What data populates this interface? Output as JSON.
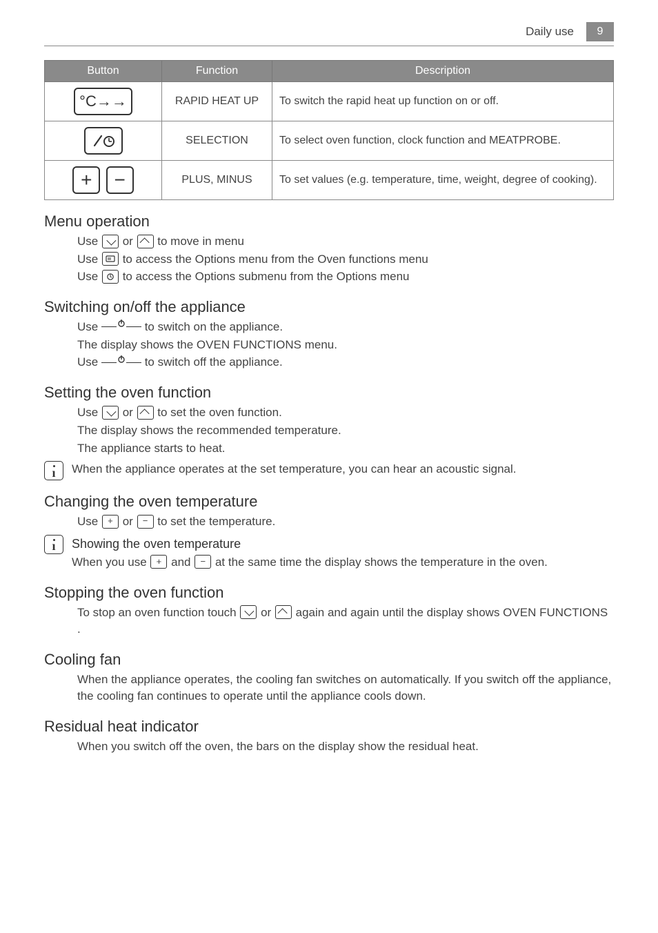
{
  "header": {
    "section": "Daily use",
    "page": "9"
  },
  "table": {
    "headers": {
      "button": "Button",
      "function": "Function",
      "description": "Description"
    },
    "rows": [
      {
        "function": "RAPID HEAT UP",
        "description": "To switch the rapid heat up function on or off."
      },
      {
        "function": "SELECTION",
        "description": "To select oven function, clock function and MEATPROBE."
      },
      {
        "function": "PLUS, MINUS",
        "description": "To set values (e.g. temperature, time, weight, degree of cooking)."
      }
    ]
  },
  "sections": {
    "menu_op": {
      "title": "Menu operation",
      "line1a": "Use ",
      "line1b": " or ",
      "line1c": " to move in menu",
      "line2a": "Use ",
      "line2b": " to access the Options menu from the Oven functions menu",
      "line3a": "Use ",
      "line3b": " to access the Options submenu from the Options menu"
    },
    "switching": {
      "title": "Switching on/off the appliance",
      "l1a": "Use ",
      "l1b": " to switch on the appliance.",
      "l2": "The display shows the OVEN FUNCTIONS menu.",
      "l3a": "Use ",
      "l3b": " to switch off the appliance."
    },
    "setting": {
      "title": "Setting the oven function",
      "l1a": "Use ",
      "l1b": " or ",
      "l1c": " to set the oven function.",
      "l2": "The display shows the recommended temperature.",
      "l3": "The appliance starts to heat.",
      "info": "When the appliance operates at the set temperature, you can hear an acoustic signal."
    },
    "changing": {
      "title": "Changing the oven temperature",
      "l1a": "Use ",
      "l1b": " or ",
      "l1c": " to set the temperature.",
      "info_title": "Showing the oven temperature",
      "info_a": "When you use ",
      "info_b": " and ",
      "info_c": " at the same time the display shows the temperature in the oven."
    },
    "stopping": {
      "title": "Stopping the oven function",
      "l1a": "To stop an oven function touch ",
      "l1b": " or ",
      "l1c": " again and again until the display shows OVEN FUNCTIONS ."
    },
    "cooling": {
      "title": "Cooling fan",
      "body": "When the appliance operates, the cooling fan switches on automatically. If you switch off the appliance, the cooling fan continues to operate until the appliance cools down."
    },
    "residual": {
      "title": "Residual heat indicator",
      "body": "When you switch off the oven, the bars on the display show the residual heat."
    }
  }
}
